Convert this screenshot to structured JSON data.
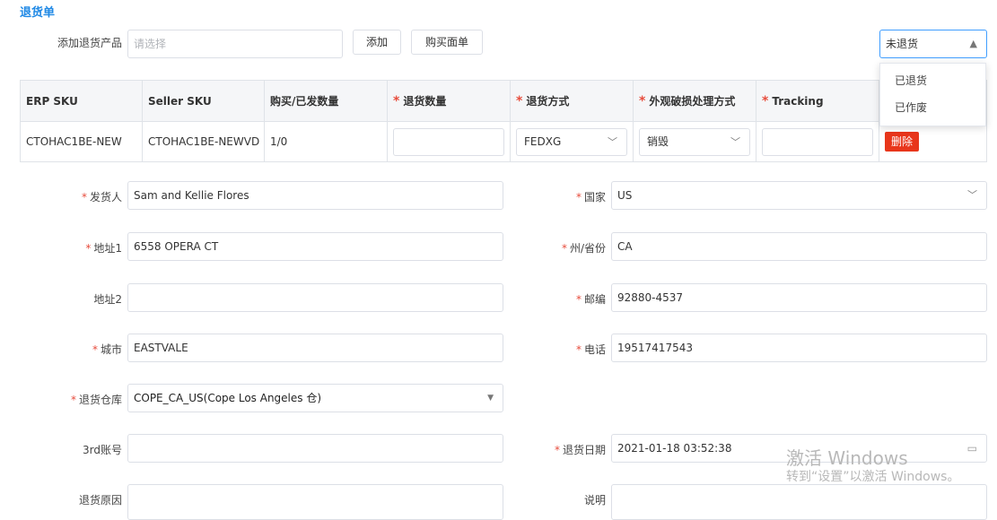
{
  "header": {
    "title": "退货单"
  },
  "toolbar": {
    "add_product_label": "添加退货产品",
    "add_product_placeholder": "请选择",
    "add_button": "添加",
    "buy_sheet_button": "购买面单"
  },
  "status_select": {
    "value": "未退货",
    "options": [
      "已退货",
      "已作废"
    ]
  },
  "table": {
    "headers": [
      "ERP SKU",
      "Seller SKU",
      "购买/已发数量",
      "退货数量",
      "退货方式",
      "外观破损处理方式",
      "Tracking"
    ],
    "row": {
      "erp_sku": "CTOHAC1BE-NEW",
      "seller_sku": "CTOHAC1BE-NEWVD",
      "qty": "1/0",
      "return_qty": "",
      "return_method": "FEDXG",
      "damage_method": "销毁",
      "tracking": "",
      "delete_label": "删除"
    }
  },
  "form": {
    "sender": {
      "label": "发货人",
      "value": "Sam and Kellie Flores"
    },
    "country": {
      "label": "国家",
      "value": "US"
    },
    "address1": {
      "label": "地址1",
      "value": "6558 OPERA CT"
    },
    "state": {
      "label": "州/省份",
      "value": "CA"
    },
    "address2": {
      "label": "地址2",
      "value": ""
    },
    "zipcode": {
      "label": "邮编",
      "value": "92880-4537"
    },
    "city": {
      "label": "城市",
      "value": "EASTVALE"
    },
    "phone": {
      "label": "电话",
      "value": "19517417543"
    },
    "warehouse": {
      "label": "退货仓库",
      "value": "COPE_CA_US(Cope Los Angeles 仓)"
    },
    "third_account": {
      "label": "3rd账号",
      "value": ""
    },
    "return_date": {
      "label": "退货日期",
      "value": "2021-01-18 03:52:38"
    },
    "reason": {
      "label": "退货原因",
      "value": ""
    },
    "note": {
      "label": "说明",
      "value": ""
    }
  },
  "watermark": {
    "line1": "激活 Windows",
    "line2": "转到“设置”以激活 Windows。"
  }
}
